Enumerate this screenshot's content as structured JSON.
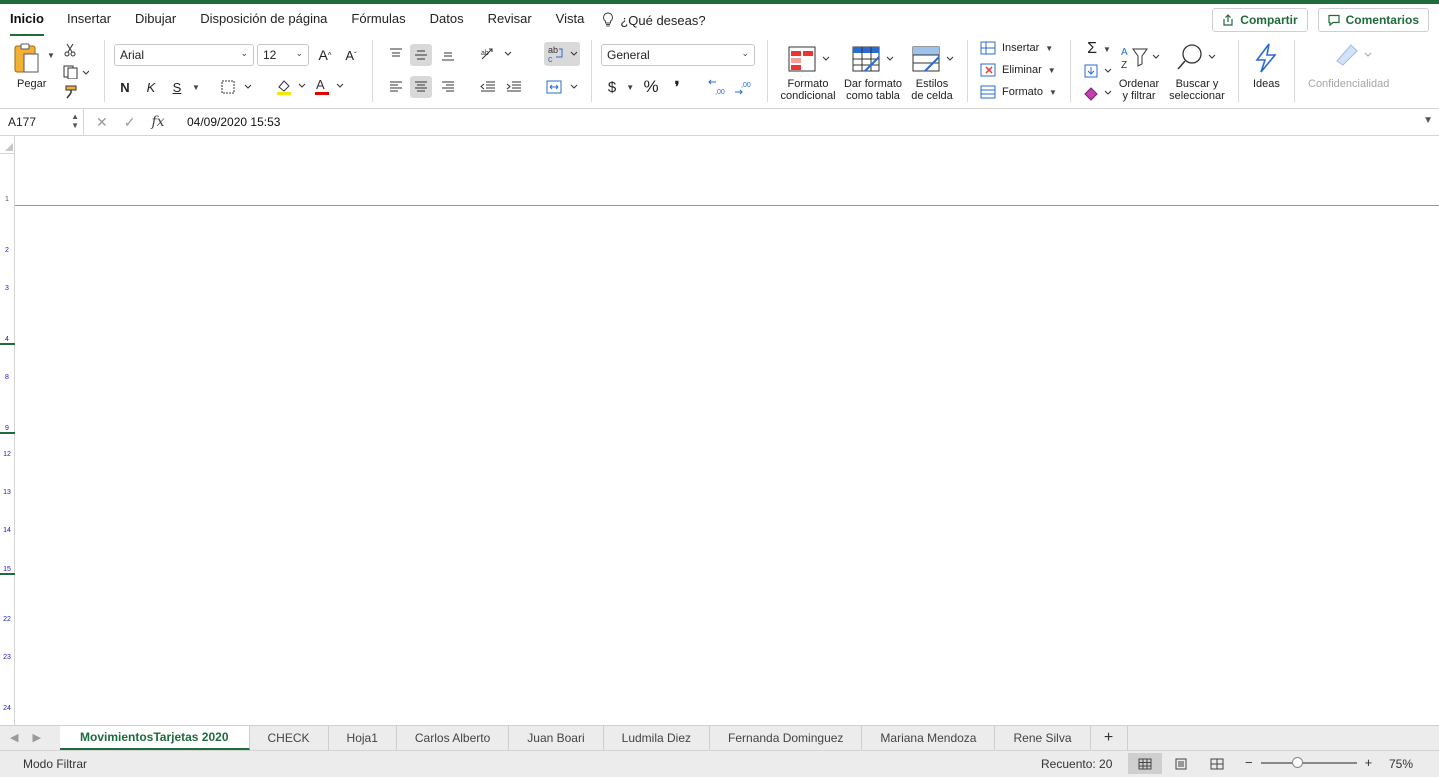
{
  "menu": {
    "tabs": [
      "Inicio",
      "Insertar",
      "Dibujar",
      "Disposición de página",
      "Fórmulas",
      "Datos",
      "Revisar",
      "Vista"
    ],
    "active_tab": "Inicio",
    "tell_me": "¿Qué deseas?",
    "share": "Compartir",
    "comments": "Comentarios"
  },
  "ribbon": {
    "paste": "Pegar",
    "font_name": "Arial",
    "font_size": "12",
    "bold": "N",
    "italic": "K",
    "underline": "S",
    "number_format": "General",
    "currency": "$",
    "percent": "%",
    "comma": "❜",
    "conditional_format": [
      "Formato",
      "condicional"
    ],
    "format_as_table": [
      "Dar formato",
      "como tabla"
    ],
    "cell_styles": [
      "Estilos",
      "de celda"
    ],
    "insert": "Insertar",
    "delete": "Eliminar",
    "format": "Formato",
    "sort_filter": [
      "Ordenar",
      "y filtrar"
    ],
    "find_select": [
      "Buscar y",
      "seleccionar"
    ],
    "ideas": "Ideas",
    "sensitivity": "Confidencialidad"
  },
  "formula_bar": {
    "name_box": "A177",
    "value": "04/09/2020 15:53",
    "fx": "fx"
  },
  "rows": [
    "1",
    "2",
    "3",
    "4",
    "8",
    "9",
    "12",
    "13",
    "14",
    "15",
    "22",
    "23",
    "24"
  ],
  "sheets": [
    "MovimientosTarjetas 2020",
    "CHECK",
    "Hoja1",
    "Carlos Alberto",
    "Juan Boari",
    "Ludmila Diez",
    "Fernanda Dominguez",
    "Mariana Mendoza",
    "Rene Silva"
  ],
  "active_sheet": "MovimientosTarjetas 2020",
  "add_sheet": "+",
  "status": {
    "mode": "Modo Filtrar",
    "count": "Recuento: 20",
    "zoom": "75%",
    "zoom_fraction": 0.38
  },
  "colors": {
    "accent": "#1e6b3c",
    "row_number": "#1a1ab8"
  }
}
